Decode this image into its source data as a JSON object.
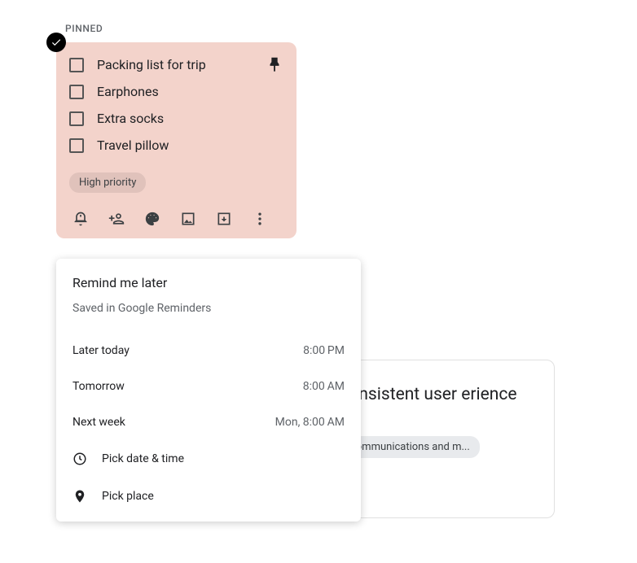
{
  "section_label": "PINNED",
  "note": {
    "items": [
      "Packing list for trip",
      "Earphones",
      "Extra socks",
      "Travel pillow"
    ],
    "tag": "High priority"
  },
  "reminder": {
    "title": "Remind me later",
    "subtitle": "Saved in Google Reminders",
    "options": [
      {
        "label": "Later today",
        "time": "8:00 PM"
      },
      {
        "label": "Tomorrow",
        "time": "8:00 AM"
      },
      {
        "label": "Next week",
        "time": "Mon, 8:00 AM"
      }
    ],
    "pick_datetime": "Pick date & time",
    "pick_place": "Pick place"
  },
  "back_card": {
    "title": "e consistent user erience",
    "chip": "elecommunications and m..."
  }
}
